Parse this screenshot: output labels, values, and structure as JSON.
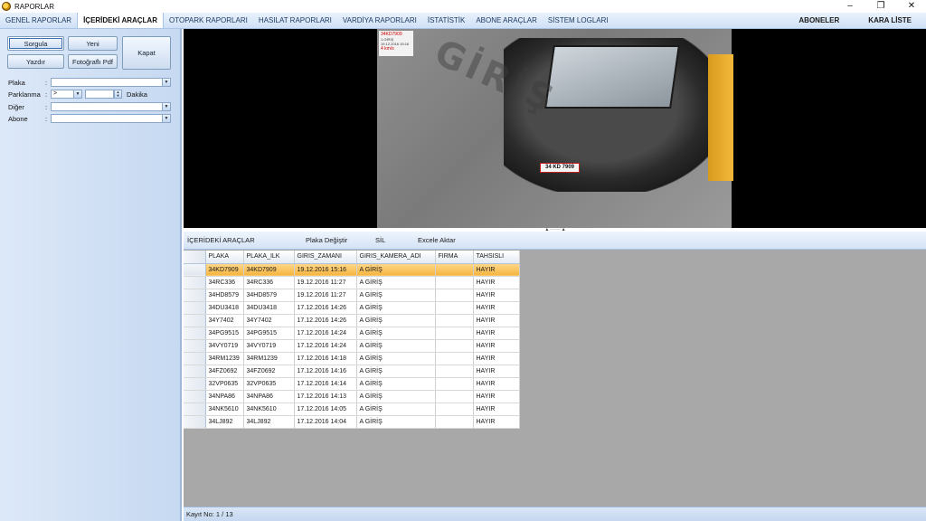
{
  "window": {
    "title": "RAPORLAR",
    "controls": [
      "–",
      "❐",
      "✕"
    ]
  },
  "menu": {
    "items": [
      "GENEL RAPORLAR",
      "İÇERİDEKİ ARAÇLAR",
      "OTOPARK RAPORLARI",
      "HASILAT RAPORLARI",
      "VARDİYA RAPORLARI",
      "İSTATİSTİK",
      "ABONE ARAÇLAR",
      "SİSTEM LOGLARI"
    ],
    "right": [
      "ABONELER",
      "KARA LİSTE"
    ]
  },
  "left": {
    "buttons": {
      "sorgula": "Sorgula",
      "yeni": "Yeni",
      "kapat": "Kapat",
      "yazdir": "Yazdır",
      "fotografli_pdf": "Fotoğraflı Pdf"
    },
    "fields": {
      "plaka_label": "Plaka",
      "parklanma_label": "Parklanma",
      "parklanma_op": ">",
      "dakika_label": "Dakika",
      "diger_label": "Diğer",
      "abone_label": "Abone",
      "colon": ":"
    }
  },
  "camera": {
    "overlay_plate": "34KD7909",
    "overlay_gate": "1.GİRİŞ",
    "overlay_time": "19.12.2016 15:16",
    "overlay_speed": "4 km/s",
    "watermark": "GİRİŞ",
    "plate_text": "34 KD 7909"
  },
  "toolbar": {
    "title": "İÇERİDEKİ ARAÇLAR",
    "plaka_degistir": "Plaka Değiştir",
    "sil": "SİL",
    "excele_aktar": "Excele Aktar"
  },
  "grid": {
    "columns": [
      "PLAKA",
      "PLAKA_ILK",
      "GIRIS_ZAMANI",
      "GIRIS_KAMERA_ADI",
      "FIRMA",
      "TAHSISLI"
    ],
    "rows": [
      [
        "34KD7909",
        "34KD7909",
        "19.12.2016 15:16",
        "A GİRİŞ",
        "",
        "HAYIR"
      ],
      [
        "34RC336",
        "34RC336",
        "19.12.2016 11:27",
        "A GİRİŞ",
        "",
        "HAYIR"
      ],
      [
        "34HD8579",
        "34HD8579",
        "19.12.2016 11:27",
        "A GİRİŞ",
        "",
        "HAYIR"
      ],
      [
        "34DU3418",
        "34DU3418",
        "17.12.2016 14:26",
        "A GİRİŞ",
        "",
        "HAYIR"
      ],
      [
        "34Y7402",
        "34Y7402",
        "17.12.2016 14:26",
        "A GİRİŞ",
        "",
        "HAYIR"
      ],
      [
        "34PG9515",
        "34PG9515",
        "17.12.2016 14:24",
        "A GİRİŞ",
        "",
        "HAYIR"
      ],
      [
        "34VY0719",
        "34VY0719",
        "17.12.2016 14:24",
        "A GİRİŞ",
        "",
        "HAYIR"
      ],
      [
        "34RM1239",
        "34RM1239",
        "17.12.2016 14:18",
        "A GİRİŞ",
        "",
        "HAYIR"
      ],
      [
        "34FZ0692",
        "34FZ0692",
        "17.12.2016 14:16",
        "A GİRİŞ",
        "",
        "HAYIR"
      ],
      [
        "32VP0635",
        "32VP0635",
        "17.12.2016 14:14",
        "A GİRİŞ",
        "",
        "HAYIR"
      ],
      [
        "34NPA86",
        "34NPA86",
        "17.12.2016 14:13",
        "A GİRİŞ",
        "",
        "HAYIR"
      ],
      [
        "34NK5610",
        "34NK5610",
        "17.12.2016 14:05",
        "A GİRİŞ",
        "",
        "HAYIR"
      ],
      [
        "34LJ892",
        "34LJ892",
        "17.12.2016 14:04",
        "A GİRİŞ",
        "",
        "HAYIR"
      ]
    ],
    "selected_row": 0
  },
  "status": {
    "record": "Kayıt No: 1 / 13"
  },
  "colors": {
    "accent": "#3b6fb6",
    "selection": "#f5b53f",
    "panel": "#c6d9f1"
  }
}
